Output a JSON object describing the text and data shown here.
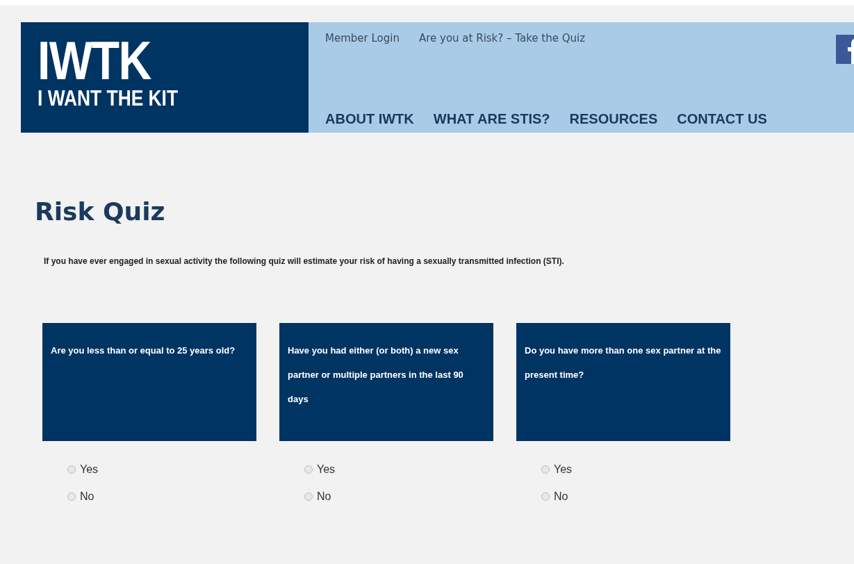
{
  "logo": {
    "title": "IWTK",
    "subtitle": "I WANT THE KIT"
  },
  "top_links": [
    "Member Login",
    "Are you at Risk? – Take the Quiz"
  ],
  "nav": [
    "ABOUT IWTK",
    "WHAT ARE STIS?",
    "RESOURCES",
    "CONTACT US"
  ],
  "heading": "Risk Quiz",
  "intro": "If you have ever engaged in sexual activity the following quiz will estimate your risk of having a sexually transmitted infection (STI).",
  "questions": [
    {
      "text": "Are you less than or equal to 25 years old?",
      "options": [
        {
          "label": "Yes",
          "selected": false
        },
        {
          "label": "No",
          "selected": false
        }
      ]
    },
    {
      "text": "Have you had either (or both) a new sex partner or multiple partners in the last 90 days",
      "options": [
        {
          "label": "Yes",
          "selected": false
        },
        {
          "label": "No",
          "selected": false
        }
      ]
    },
    {
      "text": "Do you have more than one sex partner at the present time?",
      "options": [
        {
          "label": "Yes",
          "selected": false
        },
        {
          "label": "No",
          "selected": false
        }
      ]
    }
  ]
}
